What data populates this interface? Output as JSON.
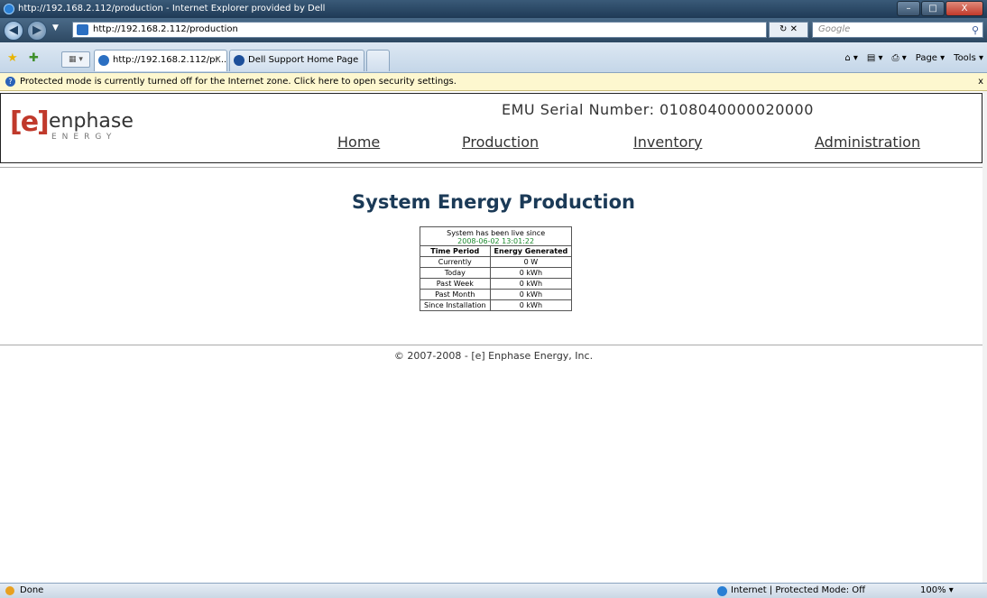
{
  "window": {
    "title": "http://192.168.2.112/production - Internet Explorer provided by Dell",
    "buttons": [
      "–",
      "□",
      "X"
    ]
  },
  "addressbar": {
    "url": "http://192.168.2.112/production",
    "refresh_stop": "↻ ✕",
    "search_placeholder": "Google"
  },
  "tabs": [
    {
      "label": "http://192.168.2.112/pr...",
      "close": "X"
    },
    {
      "label": "Dell Support Home Page"
    }
  ],
  "commandbar": {
    "home": "⌂ ▾",
    "feeds": "▤ ▾",
    "print": "⎙ ▾",
    "page": "Page ▾",
    "tools": "Tools ▾"
  },
  "infobar": {
    "message": "Protected mode is currently turned off for the Internet zone.  Click here to open security settings.",
    "close": "x"
  },
  "page": {
    "logo_bracket": "[e]",
    "logo_word": "enphase",
    "logo_sub": "ENERGY",
    "serial": "EMU Serial Number: 0108040000020000",
    "nav": [
      "Home",
      "Production",
      "Inventory",
      "Administration"
    ],
    "heading": "System Energy Production",
    "live_since_label": "System has been live since",
    "live_since_value": "2008-06-02 13:01:22",
    "table_headers": [
      "Time Period",
      "Energy Generated"
    ],
    "rows": [
      [
        "Currently",
        "0 W"
      ],
      [
        "Today",
        "0 kWh"
      ],
      [
        "Past Week",
        "0 kWh"
      ],
      [
        "Past Month",
        "0 kWh"
      ],
      [
        "Since Installation",
        "0 kWh"
      ]
    ],
    "footer": "© 2007-2008 - [e] Enphase Energy, Inc."
  },
  "status": {
    "left": "Done",
    "zone": "Internet | Protected Mode: Off",
    "zoom": "100%  ▾"
  },
  "colors": {
    "heading": "#1b3a57",
    "logo_accent": "#c0392b",
    "date_green": "#1d8a2f"
  }
}
